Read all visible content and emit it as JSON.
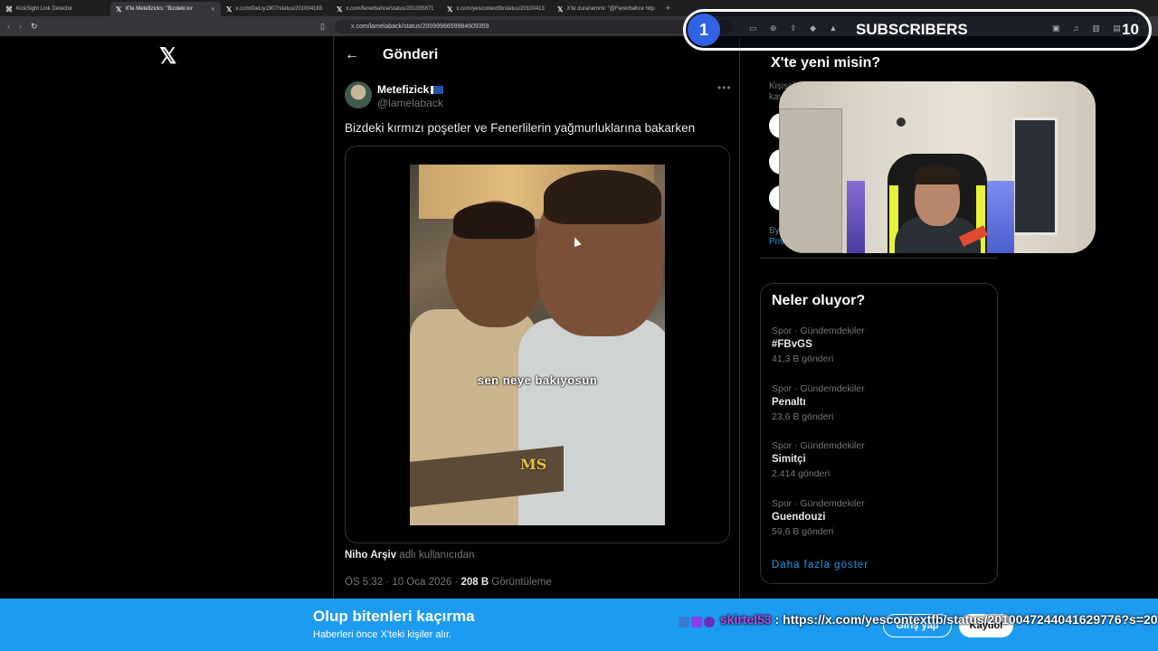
{
  "browser": {
    "tabs": [
      {
        "label": "KickSight Link Detector",
        "icon": "kicksight-icon",
        "active": false
      },
      {
        "label": "X'te Metefizicks: \"Bizdeki kır",
        "icon": "x-icon",
        "active": true
      },
      {
        "label": "x.com/DeLly1907/status/201004183",
        "icon": "x-icon",
        "active": false
      },
      {
        "label": "x.com/fenerbahce/status/201005871",
        "icon": "x-icon",
        "active": false
      },
      {
        "label": "x.com/yescontextfb/status/20100413",
        "icon": "x-icon",
        "active": false
      },
      {
        "label": "X'te duranemmi: \"@Fenerbahce http",
        "icon": "x-icon",
        "active": false
      }
    ],
    "url": "x.com/lamelaback/status/2009996659984609359"
  },
  "page": {
    "header_title": "Gönderi"
  },
  "tweet": {
    "author_name": "Metefizick",
    "author_handle": "@lamelaback",
    "text": "Bizdeki kırmızı poşetler ve Fenerlilerin yağmurluklarına bakarken",
    "video_subtitle": "sen neye bakıyosun",
    "video_watermark": "MS",
    "source_name": "Niho Arşiv",
    "source_suffix": "adlı kullanıcıdan",
    "meta_time": "ÖS 5:32 · 10 Oca 2026 ·",
    "meta_views": "208 B",
    "meta_views_label": "Görüntüleme"
  },
  "sidebar": {
    "new_title": "X'te yeni misin?",
    "new_sub_1": "Kişisel",
    "new_sub_2": "kav",
    "by_text": "By",
    "privacy_text": "Priv",
    "trends_title": "Neler oluyor?",
    "trends": [
      {
        "category": "Spor · Gündemdekiler",
        "name": "#FBvGS",
        "count": "41,3 B gönderi"
      },
      {
        "category": "Spor · Gündemdekiler",
        "name": "Penaltı",
        "count": "23,6 B gönderi"
      },
      {
        "category": "Spor · Gündemdekiler",
        "name": "Simitçi",
        "count": "2.414 gönderi"
      },
      {
        "category": "Spor · Gündemdekiler",
        "name": "Guendouzi",
        "count": "59,6 B gönderi"
      }
    ],
    "show_more": "Daha fazla göster"
  },
  "overlay": {
    "subs_number": "1",
    "subs_label": "SUBSCRIBERS",
    "subs_count": "10",
    "chat_user": "skirtel53",
    "chat_sep": " : ",
    "chat_message": "https://x.com/yescontextfb/status/2010047244041629776?s=20"
  },
  "banner": {
    "title": "Olup bitenleri kaçırma",
    "subtitle": "Haberleri önce X'teki kişiler alır.",
    "login": "Giriş yap",
    "signup": "Kaydol"
  },
  "colors": {
    "accent": "#1d9bf0",
    "subs_badge": "#2f63e4",
    "chat_user": "#b84be8"
  }
}
